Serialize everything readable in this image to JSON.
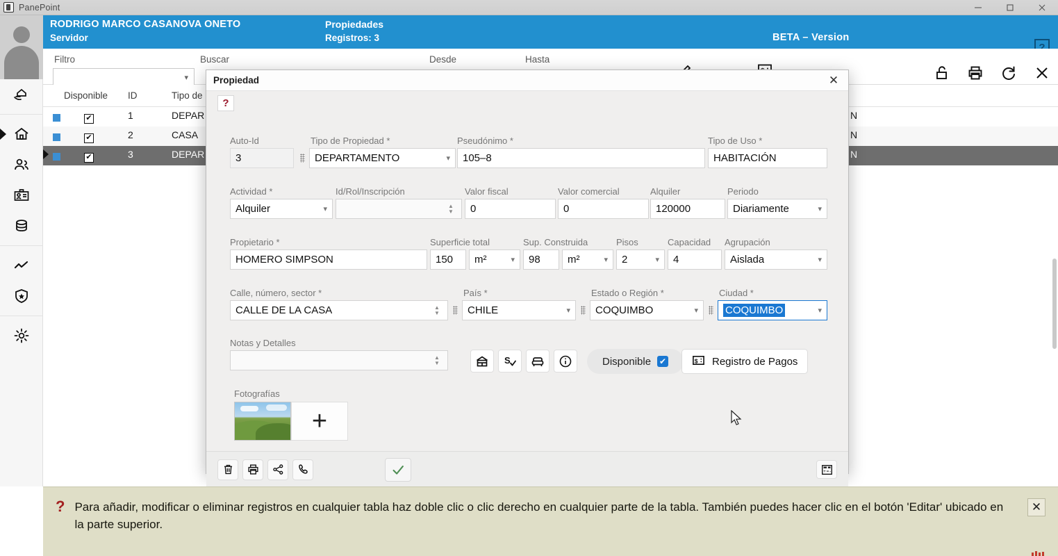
{
  "os": {
    "app_title": "PanePoint",
    "minimize": "minimize-icon",
    "maximize": "maximize-icon",
    "close": "close-icon"
  },
  "header": {
    "user_name": "RODRIGO MARCO CASANOVA ONETO",
    "user_role": "Servidor",
    "section": "Propiedades",
    "records": "Registros:  3",
    "version": "BETA – Version",
    "help": "?"
  },
  "sidebar": {
    "items": [
      {
        "name": "sidebar-item-handover",
        "icon": "hand-house-icon"
      },
      {
        "name": "sidebar-item-properties",
        "icon": "home-icon"
      },
      {
        "name": "sidebar-item-clients",
        "icon": "people-icon"
      },
      {
        "name": "sidebar-item-contracts",
        "icon": "id-card-icon"
      },
      {
        "name": "sidebar-item-database",
        "icon": "database-icon"
      },
      {
        "name": "sidebar-item-reports",
        "icon": "line-chart-icon"
      },
      {
        "name": "sidebar-item-security",
        "icon": "shield-icon"
      },
      {
        "name": "sidebar-item-settings",
        "icon": "gear-icon"
      }
    ]
  },
  "filterbar": {
    "filtro_label": "Filtro",
    "buscar_label": "Buscar",
    "desde_label": "Desde",
    "hasta_label": "Hasta",
    "filtro_value": "",
    "edit_icon": "pencil-icon",
    "payments_icon": "money-icon",
    "unlock_icon": "unlock-icon",
    "print_icon": "print-icon",
    "refresh_icon": "refresh-icon",
    "close_icon": "close-icon"
  },
  "table": {
    "columns": [
      "",
      "Disponible",
      "ID",
      "Tipo de"
    ],
    "rows": [
      {
        "available": true,
        "id": "1",
        "tipo": "DEPAR",
        "tail": "N",
        "selected": false
      },
      {
        "available": true,
        "id": "2",
        "tipo": "CASA",
        "tail": "N",
        "selected": false
      },
      {
        "available": true,
        "id": "3",
        "tipo": "DEPAR",
        "tail": "N",
        "selected": true
      }
    ]
  },
  "dialog": {
    "title": "Propiedad",
    "close_label": "✕",
    "help_label": "?",
    "fields": {
      "auto_id": {
        "label": "Auto-Id",
        "value": "3"
      },
      "tipo_propiedad": {
        "label": "Tipo de Propiedad *",
        "value": "DEPARTAMENTO"
      },
      "pseudonimo": {
        "label": "Pseudónimo *",
        "value": "105–8"
      },
      "tipo_uso": {
        "label": "Tipo de Uso *",
        "value": "HABITACIÓN"
      },
      "actividad": {
        "label": "Actividad *",
        "value": "Alquiler"
      },
      "id_rol": {
        "label": "Id/Rol/Inscripción",
        "value": ""
      },
      "valor_fiscal": {
        "label": "Valor fiscal",
        "value": "0"
      },
      "valor_comercial": {
        "label": "Valor comercial",
        "value": "0"
      },
      "alquiler": {
        "label": "Alquiler",
        "value": "120000"
      },
      "periodo": {
        "label": "Periodo",
        "value": "Diariamente"
      },
      "propietario": {
        "label": "Propietario *",
        "value": "HOMERO SIMPSON"
      },
      "superficie_total": {
        "label": "Superficie total",
        "value": "150",
        "unit": "m²"
      },
      "sup_construida": {
        "label": "Sup. Construida",
        "value": "98",
        "unit": "m²"
      },
      "pisos": {
        "label": "Pisos",
        "value": "2"
      },
      "capacidad": {
        "label": "Capacidad",
        "value": "4"
      },
      "agrupacion": {
        "label": "Agrupación",
        "value": "Aislada"
      },
      "calle": {
        "label": "Calle, número, sector *",
        "value": "CALLE DE LA CASA"
      },
      "pais": {
        "label": "País *",
        "value": "CHILE"
      },
      "estado": {
        "label": "Estado o Región *",
        "value": "COQUIMBO"
      },
      "ciudad": {
        "label": "Ciudad *",
        "value": "COQUIMBO"
      },
      "notas": {
        "label": "Notas y Detalles",
        "value": ""
      },
      "fotografias": {
        "label": "Fotografías",
        "add_label": "+"
      }
    },
    "quick_icons": [
      {
        "name": "property-icon",
        "glyph": "building-icon"
      },
      {
        "name": "payment-check-icon",
        "glyph": "money-check-icon"
      },
      {
        "name": "furniture-icon",
        "glyph": "sofa-icon"
      },
      {
        "name": "info-icon",
        "glyph": "info-circle-icon"
      }
    ],
    "disponible": {
      "label": "Disponible",
      "checked": true
    },
    "registro_pagos": {
      "label": "Registro de Pagos",
      "icon": "money-icon"
    },
    "footer_icons": [
      {
        "name": "delete-button",
        "glyph": "trash-icon"
      },
      {
        "name": "print-button",
        "glyph": "print-icon"
      },
      {
        "name": "share-button",
        "glyph": "share-icon"
      },
      {
        "name": "call-button",
        "glyph": "phone-icon"
      }
    ],
    "confirm": {
      "name": "confirm-button",
      "glyph": "check-icon"
    },
    "calculator": {
      "name": "calculator-button",
      "glyph": "calculator-icon"
    }
  },
  "help_banner": {
    "icon": "?",
    "text": "Para añadir, modificar o eliminar registros en cualquier tabla haz doble clic o clic derecho en cualquier parte de la tabla. También puedes hacer clic en el botón 'Editar' ubicado en la parte superior.",
    "close": "✕"
  }
}
